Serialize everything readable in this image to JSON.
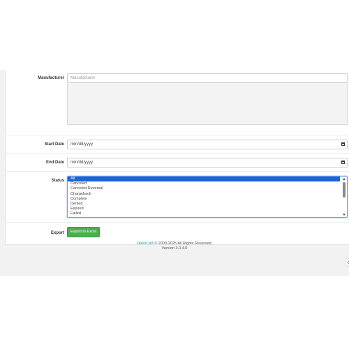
{
  "form": {
    "manufacturer": {
      "label": "Manufacturer",
      "placeholder": "Manufacturer"
    },
    "start_date": {
      "label": "Start Date",
      "value": "mm/dd/yyyy"
    },
    "end_date": {
      "label": "End Date",
      "value": "mm/dd/yyyy"
    },
    "status": {
      "label": "Status",
      "options": [
        "All",
        "Canceled",
        "Canceled Reversal",
        "Chargeback",
        "Complete",
        "Denied",
        "Expired",
        "Failed"
      ],
      "selected": "All"
    },
    "export": {
      "label": "Export",
      "button_label": "Export to Excel",
      "button_color": "#4cae4c"
    }
  },
  "footer": {
    "brand": "OpenCart",
    "copyright": "© 2009-2025 All Rights Reserved.",
    "version": "Version 3.0.4.0"
  },
  "icons": {
    "date": "calendar-icon",
    "handle": "chevron-left-icon"
  }
}
